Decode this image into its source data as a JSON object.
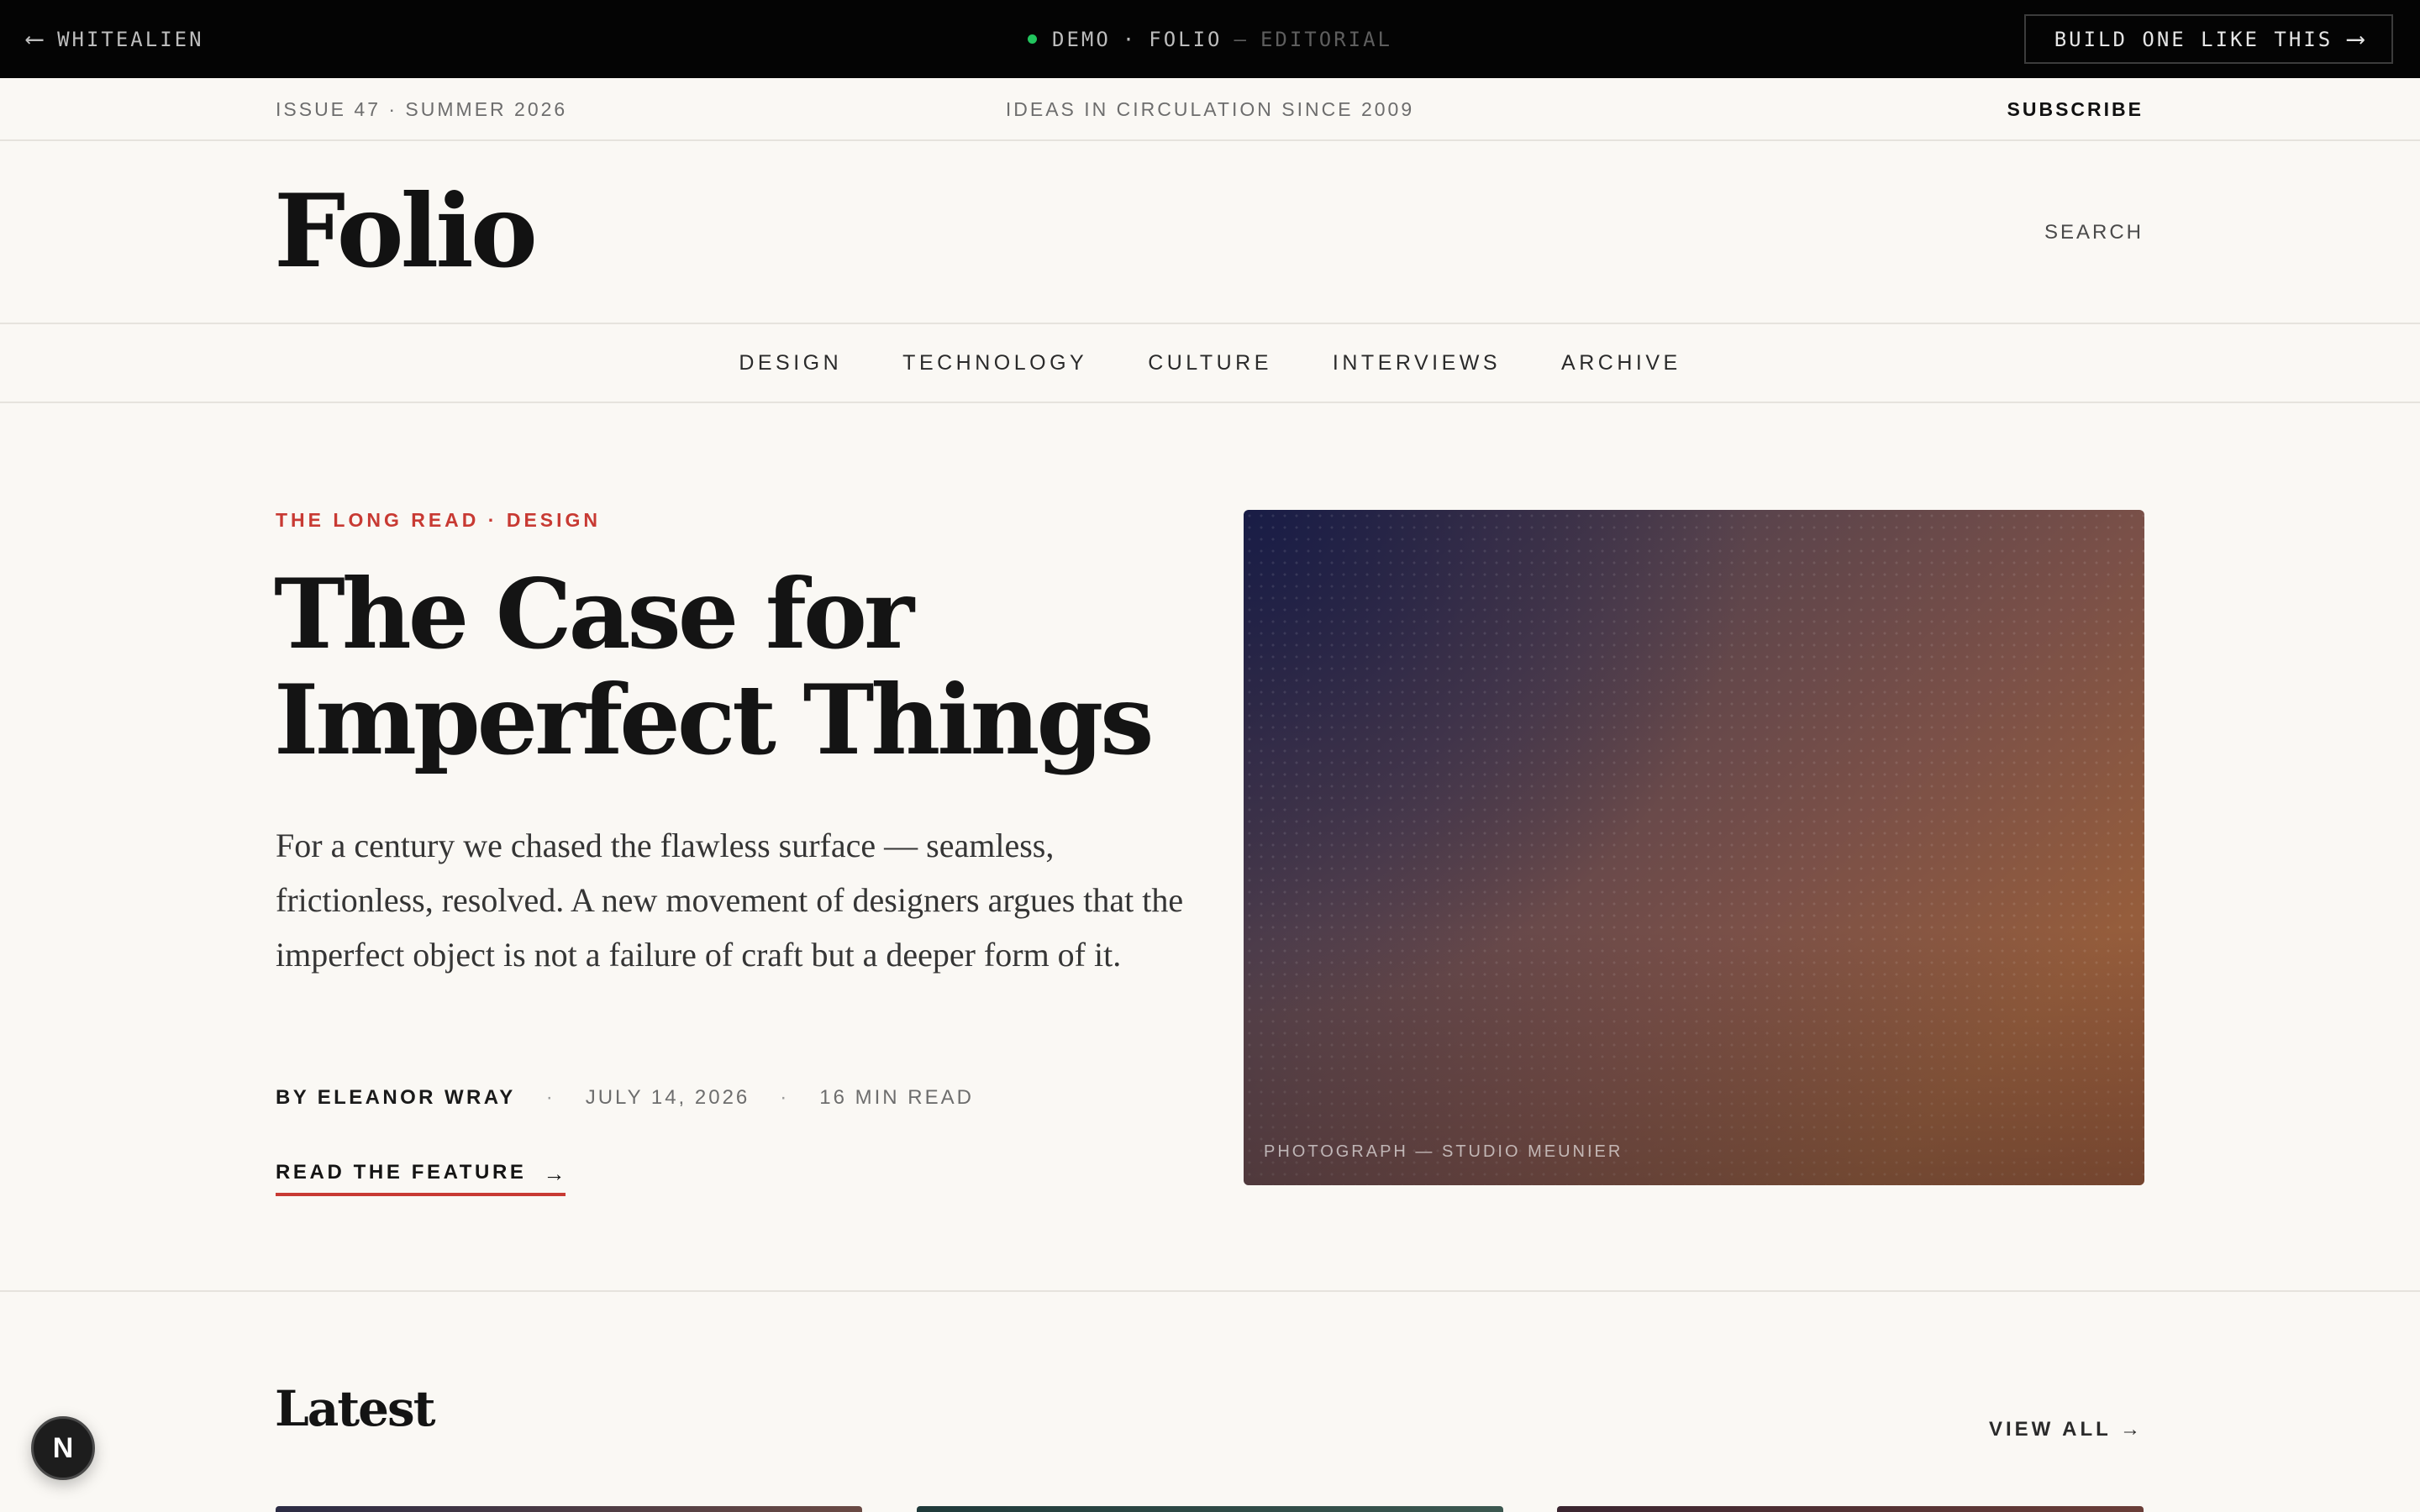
{
  "demo_bar": {
    "back_label": "WHITEALIEN",
    "demo_label": "DEMO",
    "separator": "·",
    "site_label": "FOLIO",
    "dash": "—",
    "mode_label": "EDITORIAL",
    "cta_label": "BUILD ONE LIKE THIS"
  },
  "utility": {
    "issue": "ISSUE 47 · SUMMER 2026",
    "tagline": "IDEAS IN CIRCULATION SINCE 2009",
    "subscribe": "SUBSCRIBE"
  },
  "masthead": {
    "logo": "Folio",
    "search": "SEARCH"
  },
  "nav": {
    "items": [
      {
        "label": "DESIGN"
      },
      {
        "label": "TECHNOLOGY"
      },
      {
        "label": "CULTURE"
      },
      {
        "label": "INTERVIEWS"
      },
      {
        "label": "ARCHIVE"
      }
    ]
  },
  "hero": {
    "kicker": "THE LONG READ · DESIGN",
    "headline": "The Case for Imperfect Things",
    "dek": "For a century we chased the flawless surface — seamless, frictionless, resolved. A new movement of designers argues that the imperfect object is not a failure of craft but a deeper form of it.",
    "author": "BY ELEANOR WRAY",
    "dot": "·",
    "date": "JULY 14, 2026",
    "read_time": "16 MIN READ",
    "cta": "READ THE FEATURE",
    "image_caption": "PHOTOGRAPH — STUDIO MEUNIER"
  },
  "latest": {
    "title": "Latest",
    "view_all": "VIEW ALL →"
  },
  "fab": {
    "label": "N"
  },
  "colors": {
    "accent": "#c83a33",
    "status_dot": "#22c55e",
    "background": "#faf8f4",
    "bar": "#040404"
  }
}
